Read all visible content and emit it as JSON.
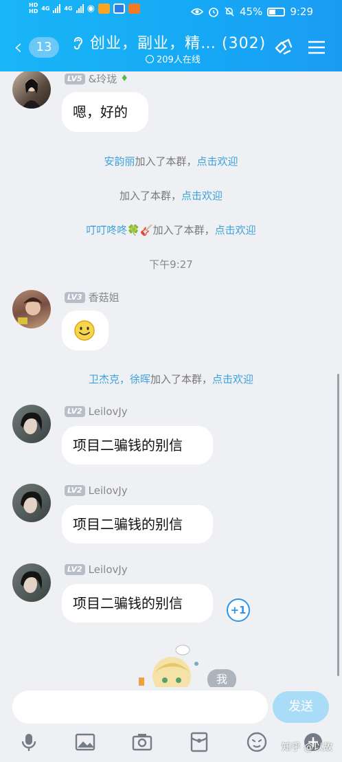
{
  "status_bar": {
    "hd_top": "HD",
    "hd_bottom": "HD",
    "net1": "4G",
    "net2": "4G",
    "battery": "45%",
    "time": "9:29"
  },
  "header": {
    "unread_count": "13",
    "title": "创业，副业，精…  (302)",
    "online_count": "209人在线"
  },
  "messages": [
    {
      "level": "LV5",
      "nick": "&玲珑",
      "text": "嗯，好的"
    },
    {
      "level": "LV3",
      "nick": "香菇姐",
      "text": "🙂"
    },
    {
      "level": "LV2",
      "nick": "LeilovJy",
      "text": "项目二骗钱的别信"
    },
    {
      "level": "LV2",
      "nick": "LeilovJy",
      "text": "项目二骗钱的别信"
    },
    {
      "level": "LV2",
      "nick": "LeilovJy",
      "text": "项目二骗钱的别信"
    }
  ],
  "system_notices": [
    {
      "name": "安韵丽",
      "rest": "加入了本群，",
      "action": "点击欢迎"
    },
    {
      "name": "",
      "rest": "加入了本群，",
      "action": "点击欢迎"
    },
    {
      "name": "叮叮咚咚🍀🎸",
      "rest": "加入了本群，",
      "action": "点击欢迎"
    },
    {
      "name": "卫杰克，徐晖",
      "rest": "加入了本群，",
      "action": "点击欢迎"
    }
  ],
  "timestamp": "下午9:27",
  "plus_one": "+1",
  "floating_wo": "我",
  "input": {
    "placeholder": "",
    "send_label": "发送"
  },
  "watermark": "知乎 @以故",
  "colors": {
    "header": "#19b6f7",
    "link": "#3ea2dc",
    "bg": "#eef0f4"
  }
}
